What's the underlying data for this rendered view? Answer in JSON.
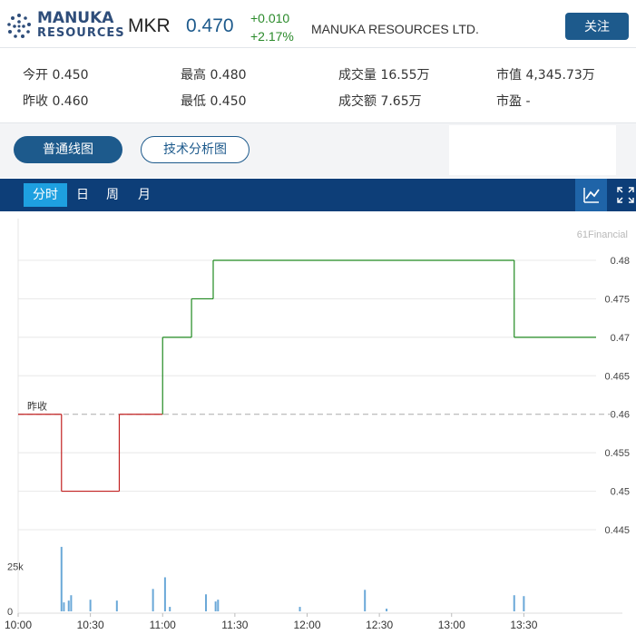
{
  "header": {
    "logo_line1": "MANUKA",
    "logo_line2": "RESOURCES",
    "symbol": "MKR",
    "price": "0.470",
    "change": "+0.010",
    "change_pct": "+2.17%",
    "company": "MANUKA RESOURCES LTD.",
    "follow_label": "关注",
    "logo_color": "#2e4d7a",
    "up_color": "#2a8a2a"
  },
  "stats": {
    "open": "今开 0.450",
    "high": "最高 0.480",
    "volume": "成交量 16.55万",
    "market_cap": "市值 4,345.73万",
    "prev_close": "昨收 0.460",
    "low": "最低 0.450",
    "turnover": "成交额 7.65万",
    "pe": "市盈 -"
  },
  "view_buttons": {
    "normal": "普通线图",
    "technical": "技术分析图"
  },
  "tabs": [
    "分时",
    "日",
    "周",
    "月"
  ],
  "tools": [
    "line-chart-icon",
    "fullscreen-icon"
  ],
  "chart_data": {
    "type": "line",
    "watermark": "61Financial",
    "prev_close_label": "昨收",
    "prev_close": 0.46,
    "ylim": [
      0.445,
      0.48
    ],
    "y_ticks": [
      "0.48",
      "0.475",
      "0.47",
      "0.465",
      "0.46",
      "0.455",
      "0.45",
      "0.445"
    ],
    "x_ticks": [
      "10:00",
      "10:30",
      "11:00",
      "11:30",
      "12:00",
      "12:30",
      "13:00",
      "13:30"
    ],
    "x_tick_minutes": [
      0,
      30,
      60,
      90,
      120,
      150,
      180,
      210
    ],
    "x_range_minutes": [
      0,
      240
    ],
    "price_series": [
      {
        "t": 0,
        "p": 0.46
      },
      {
        "t": 18,
        "p": 0.46
      },
      {
        "t": 18,
        "p": 0.45
      },
      {
        "t": 42,
        "p": 0.45
      },
      {
        "t": 42,
        "p": 0.46
      },
      {
        "t": 60,
        "p": 0.46
      },
      {
        "t": 60,
        "p": 0.47
      },
      {
        "t": 72,
        "p": 0.47
      },
      {
        "t": 72,
        "p": 0.475
      },
      {
        "t": 81,
        "p": 0.475
      },
      {
        "t": 81,
        "p": 0.48
      },
      {
        "t": 206,
        "p": 0.48
      },
      {
        "t": 206,
        "p": 0.47
      },
      {
        "t": 240,
        "p": 0.47
      }
    ],
    "down_color": "#c22020",
    "up_color": "#208a20",
    "volume_ticks": [
      "25k",
      "0"
    ],
    "volume_tick_values": [
      25000,
      0
    ],
    "volume_max": 40000,
    "volume_color": "#6aa8d8",
    "volume_bars": [
      {
        "t": 18,
        "v": 36000
      },
      {
        "t": 19,
        "v": 5000
      },
      {
        "t": 21,
        "v": 6000
      },
      {
        "t": 22,
        "v": 9000
      },
      {
        "t": 30,
        "v": 6500
      },
      {
        "t": 41,
        "v": 6000
      },
      {
        "t": 56,
        "v": 12500
      },
      {
        "t": 61,
        "v": 19000
      },
      {
        "t": 63,
        "v": 2500
      },
      {
        "t": 78,
        "v": 9500
      },
      {
        "t": 82,
        "v": 5500
      },
      {
        "t": 83,
        "v": 6500
      },
      {
        "t": 117,
        "v": 2500
      },
      {
        "t": 144,
        "v": 12000
      },
      {
        "t": 153,
        "v": 1500
      },
      {
        "t": 206,
        "v": 9000
      },
      {
        "t": 210,
        "v": 8500
      }
    ]
  }
}
